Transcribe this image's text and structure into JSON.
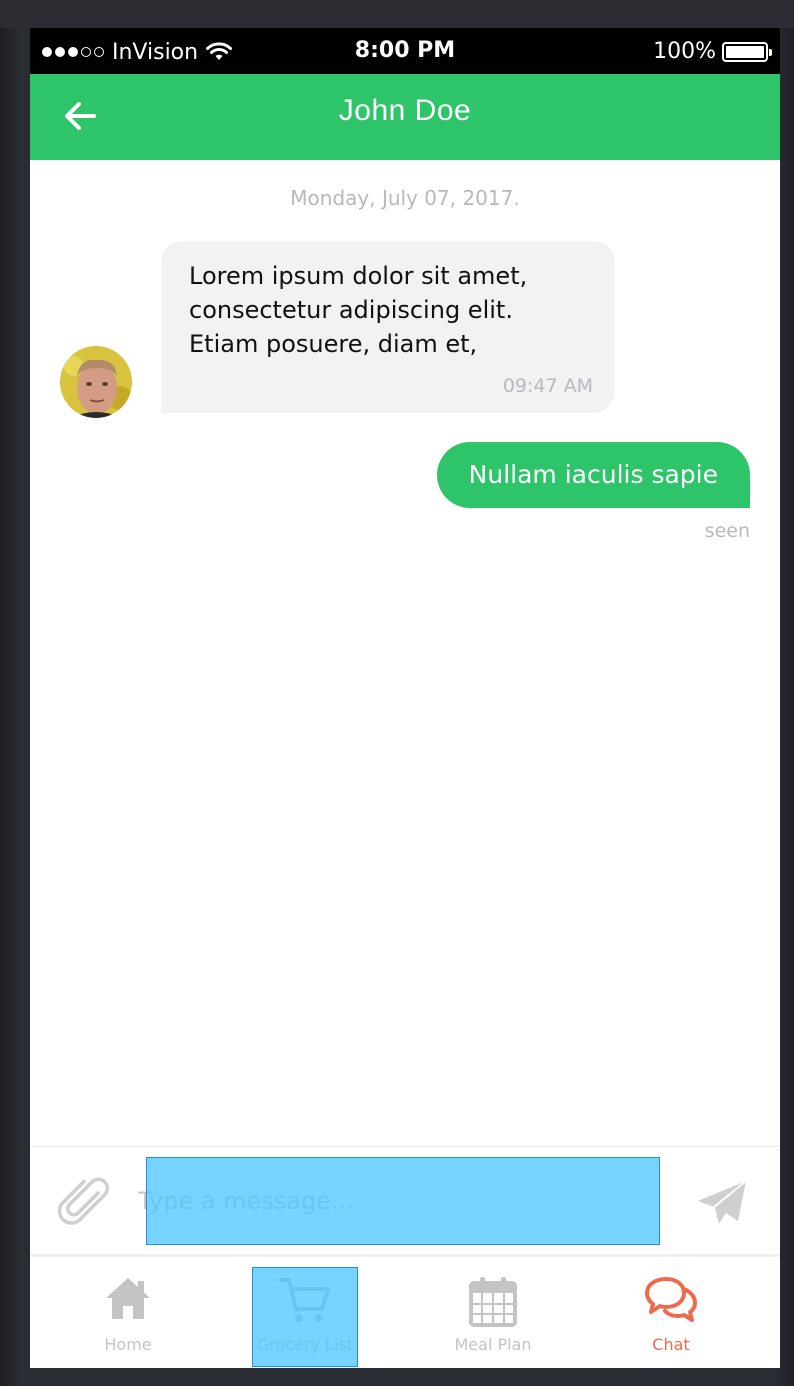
{
  "colors": {
    "brand_green": "#2ec46a",
    "chat_active": "#ee6a4d",
    "muted": "#b8b8bd",
    "highlight": "#4ac4ff"
  },
  "status_bar": {
    "carrier": "InVision",
    "time": "8:00 PM",
    "battery_percent": "100%",
    "signal_icon": "signal-dots-icon",
    "wifi_icon": "wifi-icon",
    "battery_icon": "battery-icon"
  },
  "header": {
    "title": "John Doe",
    "back_icon": "arrow-left-icon"
  },
  "conversation": {
    "date_label": "Monday, July 07, 2017.",
    "messages": [
      {
        "direction": "incoming",
        "text": "Lorem ipsum dolor sit amet,\nconsectetur adipiscing elit.\nEtiam posuere, diam et,",
        "time": "09:47 AM"
      },
      {
        "direction": "outgoing",
        "text": "Nullam iaculis sapie",
        "status": "seen"
      }
    ]
  },
  "composer": {
    "placeholder": "Type a message...",
    "value": "",
    "attach_icon": "paperclip-icon",
    "send_icon": "paper-plane-icon"
  },
  "tabbar": {
    "tabs": [
      {
        "label": "Home",
        "icon": "home-icon",
        "active": false
      },
      {
        "label": "Grocery List",
        "icon": "cart-icon",
        "active": false
      },
      {
        "label": "Meal Plan",
        "icon": "calendar-icon",
        "active": false
      },
      {
        "label": "Chat",
        "icon": "chat-bubbles-icon",
        "active": true
      }
    ]
  }
}
